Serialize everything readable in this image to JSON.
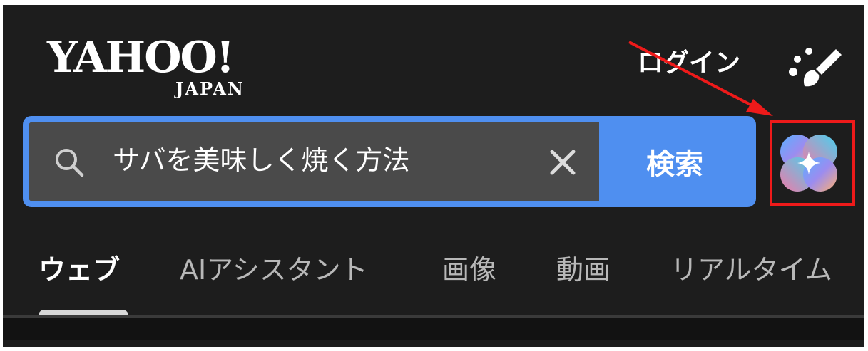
{
  "header": {
    "logo_main": "YAHOO!",
    "logo_sub": "JAPAN",
    "login_label": "ログイン",
    "theme_icon": "palette-brush-icon"
  },
  "search": {
    "query": "サバを美味しく焼く方法",
    "search_icon": "search-icon",
    "clear_icon": "close-icon",
    "button_label": "検索",
    "accent_color": "#4f8ff0"
  },
  "ai_assistant_button": {
    "icon": "ai-sparkle-icon",
    "highlight_color": "#ee1a1a"
  },
  "tabs": [
    {
      "label": "ウェブ",
      "active": true
    },
    {
      "label": "AIアシスタント",
      "active": false
    },
    {
      "label": "画像",
      "active": false
    },
    {
      "label": "動画",
      "active": false
    },
    {
      "label": "リアルタイム",
      "active": false
    }
  ]
}
